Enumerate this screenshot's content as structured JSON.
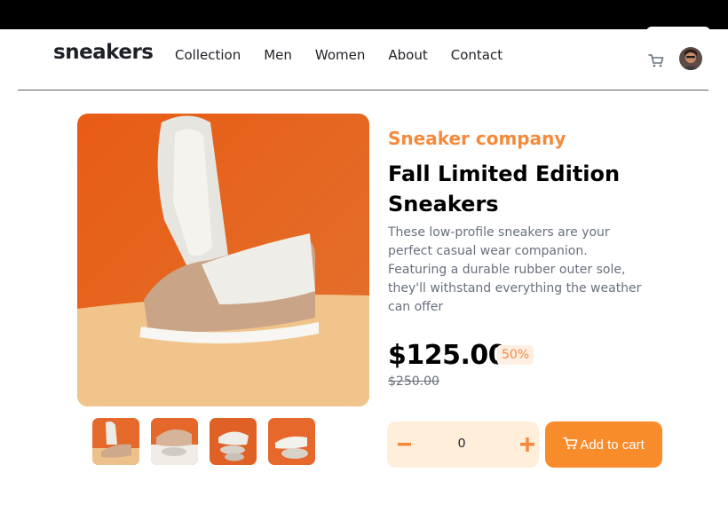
{
  "brand": {
    "logo_text": "sneakers",
    "accent": "#f58a3c"
  },
  "nav": {
    "items": [
      "Collection",
      "Men",
      "Women",
      "About",
      "Contact"
    ]
  },
  "header_icons": {
    "cart": "cart-icon",
    "avatar": "avatar"
  },
  "product": {
    "company": "Sneaker company",
    "title": "Fall Limited Edition Sneakers",
    "description": "These low-profile sneakers are your perfect casual wear companion. Featuring a durable rubber outer sole, they'll withstand everything the weather can offer",
    "price": "$125.00",
    "discount": "50%",
    "original_price": "$250.00"
  },
  "gallery": {
    "thumbnail_count": 4
  },
  "cart_controls": {
    "quantity": "0",
    "minus_icon": "minus-icon",
    "plus_icon": "plus-icon",
    "add_label": "Add to cart"
  }
}
